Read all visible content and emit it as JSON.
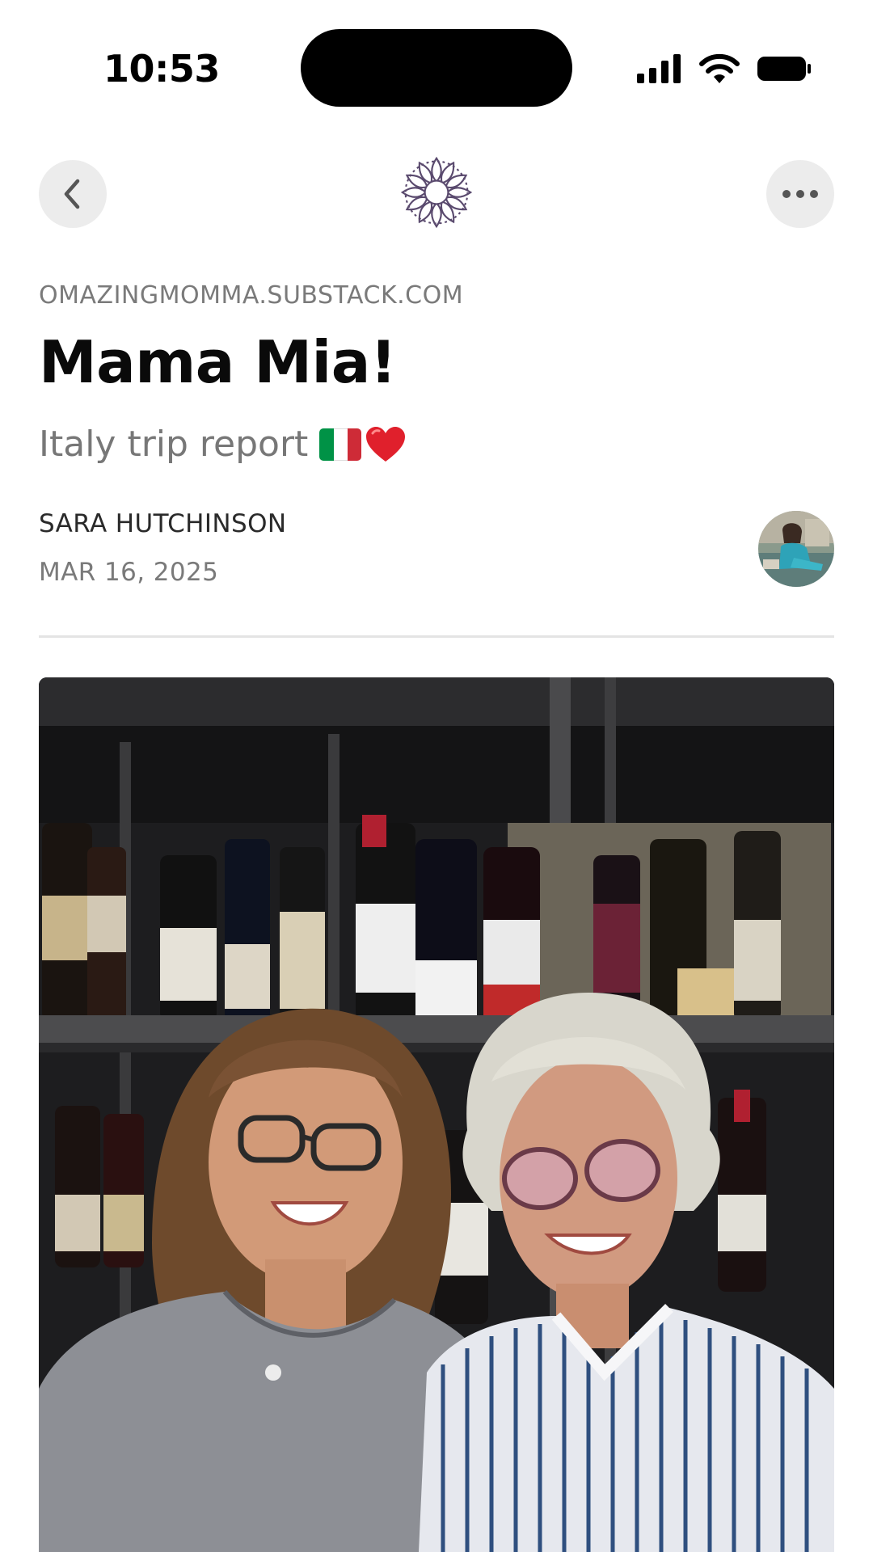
{
  "status_bar": {
    "time": "10:53"
  },
  "nav": {
    "back_icon": "chevron-left-icon",
    "logo_icon": "mandala-logo-icon",
    "more_icon": "ellipsis-icon"
  },
  "post": {
    "publication": "OMAZINGMOMMA.SUBSTACK.COM",
    "title": "Mama Mia!",
    "subtitle": "Italy trip report",
    "subtitle_emoji": [
      "italy-flag",
      "red-heart"
    ],
    "author": "SARA HUTCHINSON",
    "date": "MAR 16, 2025"
  },
  "colors": {
    "accent_logo": "#5a4a6e",
    "muted_text": "#7a7a7a",
    "flag_green": "#009246",
    "flag_white": "#ffffff",
    "flag_red": "#ce2b37",
    "heart_red": "#e0202c"
  }
}
